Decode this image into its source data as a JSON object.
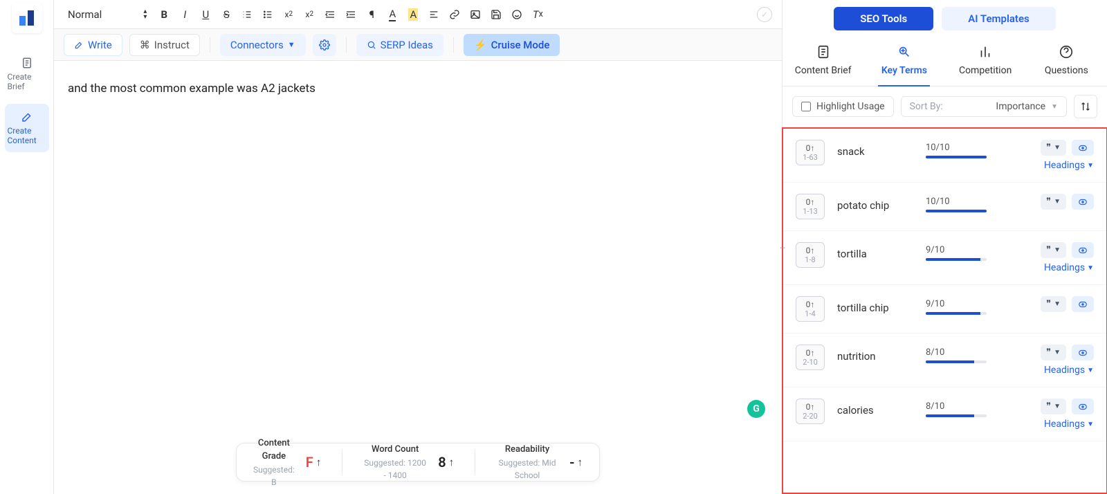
{
  "leftRail": {
    "createBrief": "Create Brief",
    "createContent": "Create Content"
  },
  "formatBar": {
    "style": "Normal"
  },
  "actionBar": {
    "write": "Write",
    "instruct": "Instruct",
    "connectors": "Connectors",
    "serpIdeas": "SERP Ideas",
    "cruiseMode": "Cruise Mode"
  },
  "editor": {
    "content": "and the most common example was A2 jackets"
  },
  "statusBar": {
    "grade": {
      "title": "Content Grade",
      "sub": "Suggested: B",
      "value": "F"
    },
    "wordCount": {
      "title": "Word Count",
      "sub": "Suggested: 1200 - 1400",
      "value": "8"
    },
    "readability": {
      "title": "Readability",
      "sub": "Suggested: Mid School",
      "value": "-"
    }
  },
  "rightPanel": {
    "topTabs": {
      "seo": "SEO Tools",
      "ai": "AI Templates"
    },
    "subTabs": {
      "brief": "Content Brief",
      "keyTerms": "Key Terms",
      "competition": "Competition",
      "questions": "Questions"
    },
    "filters": {
      "highlight": "Highlight Usage",
      "sortLabel": "Sort By:",
      "sortValue": "Importance"
    },
    "headingsLabel": "Headings",
    "terms": [
      {
        "count": "0↑",
        "range": "1-63",
        "name": "snack",
        "score": "10/10",
        "fill": 100,
        "showHeadings": true
      },
      {
        "count": "0↑",
        "range": "1-13",
        "name": "potato chip",
        "score": "10/10",
        "fill": 100,
        "showHeadings": false
      },
      {
        "count": "0↑",
        "range": "1-8",
        "name": "tortilla",
        "score": "9/10",
        "fill": 90,
        "showHeadings": true
      },
      {
        "count": "0↑",
        "range": "1-4",
        "name": "tortilla chip",
        "score": "9/10",
        "fill": 90,
        "showHeadings": false
      },
      {
        "count": "0↑",
        "range": "2-10",
        "name": "nutrition",
        "score": "8/10",
        "fill": 80,
        "showHeadings": true
      },
      {
        "count": "0↑",
        "range": "2-20",
        "name": "calories",
        "score": "8/10",
        "fill": 80,
        "showHeadings": true
      }
    ]
  }
}
